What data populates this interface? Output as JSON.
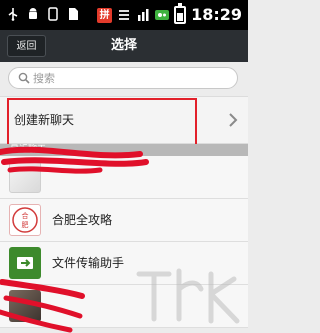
{
  "status_bar": {
    "time": "18:29",
    "badge_text": "拼",
    "icons": [
      "usb-icon",
      "android-debug-icon",
      "phone-icon",
      "sim-icon",
      "pin-app-icon",
      "lines-icon",
      "chart-icon",
      "wechat-icon",
      "battery-icon"
    ]
  },
  "header": {
    "back_label": "返回",
    "title": "选择"
  },
  "search": {
    "placeholder": "搜索"
  },
  "new_chat": {
    "label": "创建新聊天"
  },
  "section": {
    "label": "最近聊天"
  },
  "list": [
    {
      "label": "",
      "avatar": "game-avatar"
    },
    {
      "label": "合肥全攻略",
      "avatar": "hefei-avatar",
      "avatar_text": "合肥"
    },
    {
      "label": "文件传输助手",
      "avatar": "file-transfer-avatar"
    },
    {
      "label": "",
      "avatar": "photo-avatar"
    }
  ],
  "colors": {
    "title_bar": "#2b2f33",
    "highlight": "#e2202a",
    "redaction": "#e0102a",
    "file_icon_green": "#3d8a2c"
  }
}
